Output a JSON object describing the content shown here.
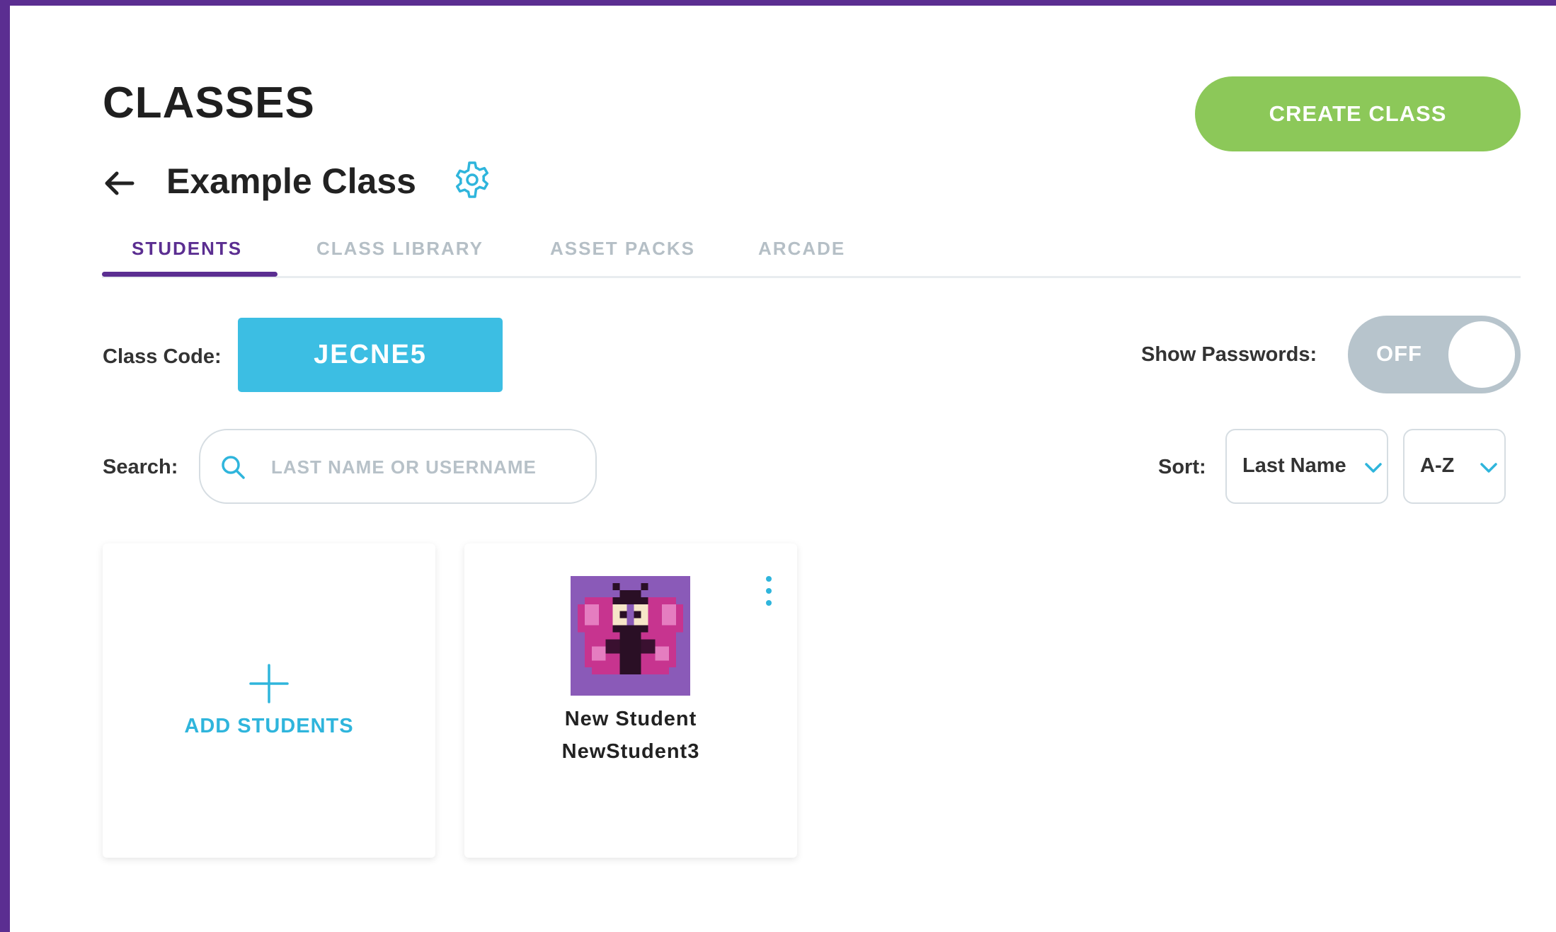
{
  "header": {
    "title": "CLASSES",
    "create_button": "CREATE CLASS"
  },
  "class": {
    "name": "Example Class"
  },
  "tabs": [
    {
      "label": "STUDENTS",
      "active": true
    },
    {
      "label": "CLASS LIBRARY",
      "active": false
    },
    {
      "label": "ASSET PACKS",
      "active": false
    },
    {
      "label": "ARCADE",
      "active": false
    }
  ],
  "class_code": {
    "label": "Class Code:",
    "value": "JECNE5"
  },
  "show_passwords": {
    "label": "Show Passwords:",
    "state": "OFF"
  },
  "search": {
    "label": "Search:",
    "placeholder": "LAST NAME OR USERNAME",
    "value": ""
  },
  "sort": {
    "label": "Sort:",
    "field": "Last Name",
    "order": "A-Z"
  },
  "add_students": {
    "label": "ADD STUDENTS"
  },
  "students": [
    {
      "name": "New Student",
      "username": "NewStudent3",
      "avatar": "butterfly-avatar"
    }
  ],
  "colors": {
    "brand_purple": "#5b2e91",
    "create_green": "#8cc859",
    "code_blue": "#3cbee3",
    "toggle_off": "#b7c4cc",
    "accent_cyan": "#2fb5dc"
  }
}
